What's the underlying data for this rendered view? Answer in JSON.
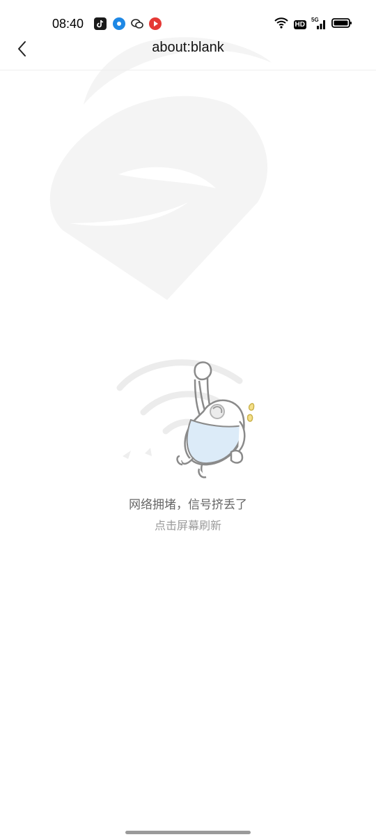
{
  "status_bar": {
    "time": "08:40",
    "notification_icons": [
      "tiktok-icon",
      "location-icon",
      "wechat-icon",
      "video-app-icon"
    ],
    "right_icons": [
      "wifi-icon",
      "hd-icon",
      "5g-signal-icon",
      "battery-icon"
    ],
    "hd_label": "HD",
    "network_label": "5G"
  },
  "toolbar": {
    "title": "about:blank",
    "back_icon": "chevron-left-icon"
  },
  "error": {
    "message": "网络拥堵，信号挤丢了",
    "action": "点击屏幕刷新"
  },
  "colors": {
    "watermark": "#f3f3f3",
    "message": "#666666",
    "action": "#9a9a9a",
    "mascot_fill": "#dcebf8"
  }
}
